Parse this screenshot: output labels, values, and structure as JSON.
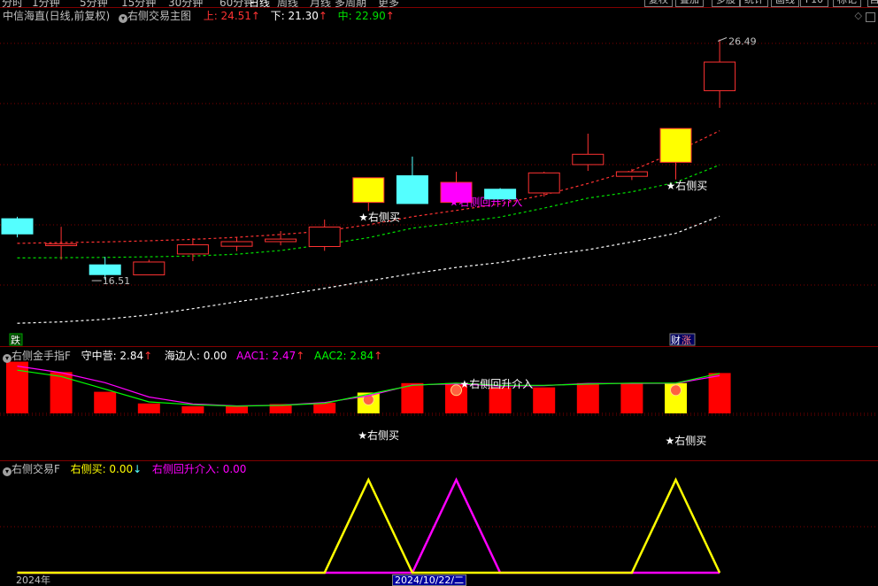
{
  "toolbar": {
    "periods": [
      {
        "label": "分时",
        "active": false
      },
      {
        "label": "1分钟",
        "active": false
      },
      {
        "label": "5分钟",
        "active": false
      },
      {
        "label": "15分钟",
        "active": false
      },
      {
        "label": "30分钟",
        "active": false
      },
      {
        "label": "60分钟",
        "active": false
      },
      {
        "label": "日线",
        "active": true
      },
      {
        "label": "周线",
        "active": false
      },
      {
        "label": "月线",
        "active": false
      },
      {
        "label": "多周期",
        "active": false
      },
      {
        "label": "更多",
        "active": false
      }
    ],
    "buttons": [
      "复权",
      "叠加",
      "多股",
      "统计",
      "画线",
      "F10",
      "标记",
      "自"
    ]
  },
  "main_panel": {
    "stock_title": "中信海直(日线,前复权)",
    "indicator_name": "右侧交易主图",
    "upper_label": "上: 24.51",
    "lower_label": "下: 21.30",
    "middle_label": "中: 22.90",
    "high_label": "26.49",
    "low_label": "16.51",
    "down_badge": "跌",
    "finance_badge": "财",
    "rise_badge": "涨",
    "signal_buy": "★右侧买",
    "signal_reentry": "★右侧回升介入",
    "colors": {
      "up": "#ff3232",
      "down": "#54ffff",
      "upper_band": "#ff3232",
      "mid_band": "#00e000",
      "lower_band": "#ffffff",
      "signal": "#ffff00",
      "reentry": "#ff00ff"
    }
  },
  "candles": {
    "type": "candlestick",
    "y_range": [
      16.0,
      27.0
    ],
    "data": [
      {
        "o": 20.23,
        "c": 19.7,
        "h": 20.3,
        "l": 19.58,
        "mark": "down"
      },
      {
        "o": 19.29,
        "c": 19.35,
        "h": 19.95,
        "l": 18.8,
        "mark": "up"
      },
      {
        "o": 18.62,
        "c": 18.28,
        "h": 18.9,
        "l": 18.1,
        "mark": "down"
      },
      {
        "o": 18.27,
        "c": 18.72,
        "h": 18.8,
        "l": 18.27,
        "mark": "up"
      },
      {
        "o": 19.0,
        "c": 19.32,
        "h": 19.55,
        "l": 18.75,
        "mark": "up"
      },
      {
        "o": 19.27,
        "c": 19.43,
        "h": 19.6,
        "l": 19.1,
        "mark": "up"
      },
      {
        "o": 19.43,
        "c": 19.52,
        "h": 19.8,
        "l": 19.3,
        "mark": "up"
      },
      {
        "o": 19.26,
        "c": 19.94,
        "h": 20.2,
        "l": 19.11,
        "mark": "up"
      },
      {
        "o": 20.8,
        "c": 21.66,
        "h": 21.66,
        "l": 20.5,
        "mark": "yellow",
        "signal": "buy"
      },
      {
        "o": 21.73,
        "c": 20.76,
        "h": 22.4,
        "l": 20.76,
        "mark": "down"
      },
      {
        "o": 21.5,
        "c": 20.8,
        "h": 21.87,
        "l": 20.8,
        "mark": "magenta",
        "signal": "reentry"
      },
      {
        "o": 21.26,
        "c": 20.92,
        "h": 21.3,
        "l": 20.92,
        "mark": "down"
      },
      {
        "o": 21.13,
        "c": 21.83,
        "h": 21.87,
        "l": 21.0,
        "mark": "up"
      },
      {
        "o": 22.12,
        "c": 22.48,
        "h": 23.2,
        "l": 21.9,
        "mark": "up"
      },
      {
        "o": 21.71,
        "c": 21.87,
        "h": 21.97,
        "l": 21.58,
        "mark": "down"
      },
      {
        "o": 22.2,
        "c": 23.38,
        "h": 23.38,
        "l": 21.6,
        "mark": "yellow",
        "signal": "buy"
      },
      {
        "o": 24.7,
        "c": 25.7,
        "h": 26.49,
        "l": 24.1,
        "mark": "up"
      }
    ],
    "upper_band": [
      19.37,
      19.4,
      19.42,
      19.46,
      19.51,
      19.58,
      19.68,
      19.8,
      20.02,
      20.3,
      20.52,
      20.75,
      21.06,
      21.46,
      21.91,
      22.56,
      23.3
    ],
    "middle_band": [
      18.86,
      18.87,
      18.88,
      18.9,
      18.93,
      18.99,
      19.12,
      19.33,
      19.57,
      19.9,
      20.09,
      20.29,
      20.6,
      20.95,
      21.17,
      21.5,
      22.11
    ],
    "lower_band": [
      16.58,
      16.63,
      16.72,
      16.87,
      17.09,
      17.33,
      17.55,
      17.8,
      18.06,
      18.31,
      18.53,
      18.7,
      18.95,
      19.15,
      19.42,
      19.72,
      20.32
    ]
  },
  "panel2": {
    "name": "右侧金手指F",
    "label_guard": "守中营: 2.84",
    "label_sea": "海边人: 0.00",
    "label_aac1": "AAC1: 2.47",
    "label_aac2": "AAC2: 2.84",
    "signal_reentry": "★右侧回升介入",
    "signal_buy_1": "★右侧买",
    "signal_buy_2": "★右侧买",
    "colors": {
      "guard": "#ffffff",
      "aac1": "#ff00ff",
      "aac2": "#00ff00",
      "bar": "#ff0000",
      "hl": "#ffff00"
    }
  },
  "panel2_data": {
    "type": "bar",
    "y_range": [
      0,
      3.2
    ],
    "bars": [
      3.28,
      2.62,
      1.37,
      0.63,
      0.45,
      0.45,
      0.59,
      0.68,
      1.32,
      1.92,
      1.92,
      1.65,
      1.65,
      1.92,
      1.92,
      1.92,
      2.56
    ],
    "highlight": [
      false,
      false,
      false,
      false,
      false,
      false,
      false,
      false,
      true,
      false,
      false,
      false,
      false,
      false,
      false,
      true,
      false
    ],
    "badges": [
      false,
      false,
      false,
      false,
      false,
      false,
      false,
      false,
      true,
      false,
      true,
      false,
      false,
      false,
      false,
      true,
      false
    ],
    "aac1": [
      3.0,
      2.58,
      1.95,
      1.04,
      0.6,
      0.47,
      0.52,
      0.69,
      1.12,
      1.81,
      1.87,
      1.73,
      1.76,
      1.9,
      1.9,
      1.91,
      2.39
    ],
    "aac2": [
      2.74,
      2.34,
      1.54,
      0.73,
      0.55,
      0.46,
      0.51,
      0.64,
      1.21,
      1.78,
      1.92,
      1.78,
      1.78,
      1.86,
      1.92,
      1.92,
      2.54
    ]
  },
  "panel3": {
    "name": "右侧交易F",
    "label_buy": "右侧买: 0.00",
    "label_reentry": "右侧回升介入: 0.00",
    "colors": {
      "buy": "#ffff00",
      "reentry": "#ff00ff"
    }
  },
  "panel3_data": {
    "type": "line",
    "y_range": [
      0,
      1
    ],
    "buy": [
      0,
      0,
      0,
      0,
      0,
      0,
      0,
      0,
      1,
      0,
      0,
      0,
      0,
      0,
      0,
      1,
      0
    ],
    "reentry": [
      0,
      0,
      0,
      0,
      0,
      0,
      0,
      0,
      0,
      0,
      1,
      0,
      0,
      0,
      0,
      0,
      0
    ]
  },
  "x_axis": {
    "start_label": "2024年",
    "cursor_label": "2024/10/22/二"
  }
}
